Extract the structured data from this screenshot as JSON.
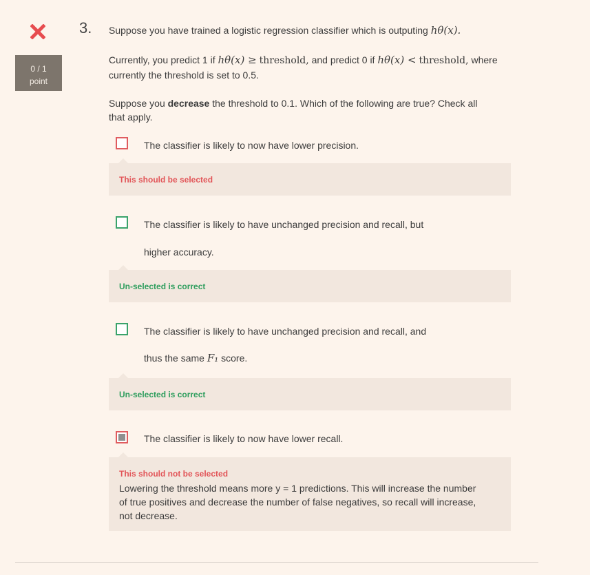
{
  "status": {
    "icon": "close-icon",
    "color": "#e74c4f"
  },
  "score": {
    "value": "0 / 1",
    "unit": "point"
  },
  "question": {
    "number": "3.",
    "intro_text": "Suppose you have trained a logistic regression classifier which is outputing",
    "intro_math": "hθ(x).",
    "current_1": "Currently, you predict 1 if",
    "current_math1": "hθ(x) ≥",
    "current_word1": "threshold,",
    "current_2": "and predict 0 if",
    "current_math2": "hθ(x) <",
    "current_word2": "threshold,",
    "current_3": "where",
    "current_line2": "currently the threshold is set to 0.5.",
    "task_1": "Suppose you",
    "task_bold": "decrease",
    "task_2": "the threshold to 0.1. Which of the following are true? Check all",
    "task_line2": "that apply."
  },
  "options": [
    {
      "line1": "The classifier is likely to now have lower precision.",
      "feedback_title": "This should be selected",
      "checked": false
    },
    {
      "line1": "The classifier is likely to have unchanged precision and recall, but",
      "line2": "higher accuracy.",
      "feedback_title": "Un-selected is correct",
      "checked": false
    },
    {
      "line1": "The classifier is likely to have unchanged precision and recall, and",
      "line2_pre": "thus the same",
      "line2_math": "F₁",
      "line2_post": "score.",
      "feedback_title": "Un-selected is correct",
      "checked": false
    },
    {
      "line1": "The classifier is likely to now have lower recall.",
      "feedback_title": "This should not be selected",
      "feedback_body": "Lowering the threshold means more y = 1 predictions. This will increase the number of true positives and decrease the number of false negatives, so recall will increase, not decrease.",
      "checked": true
    }
  ],
  "colors": {
    "incorrect": "#e05c5f",
    "correct": "#3aa36b",
    "feedback_bg": "#f2e7de",
    "page_bg": "#fdf4ec"
  }
}
